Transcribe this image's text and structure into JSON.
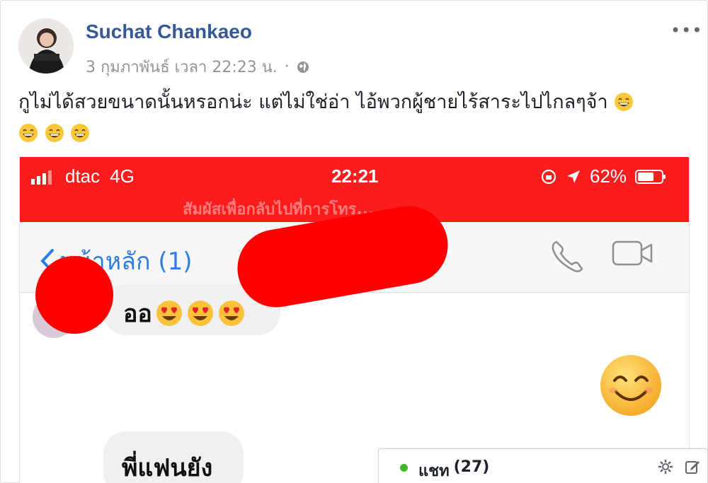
{
  "post": {
    "author": "Suchat Chankaeo",
    "date": "3 กุมภาพันธ์ เวลา 22:23 น.",
    "separator": "·",
    "more_label": "•••",
    "text_line1": "กูไม่ได้สวยขนาดนั้นหรอกน่ะ แต่ไม่ใช่อ่า ไอ้พวกผู้ชายไร้สาระไปไกลๆจ้า",
    "icons": {
      "privacy": "globe-icon",
      "emoji": "grinning-face-icon"
    }
  },
  "screenshot": {
    "status_bar": {
      "carrier": "dtac",
      "network": "4G",
      "time": "22:21",
      "battery": "62%",
      "faded_banner": "สัมผัสเพื่อกลับไปที่การโทร..."
    },
    "nav": {
      "back_label": "หน้าหลัก (1)",
      "icons": [
        "phone-icon",
        "video-call-icon"
      ]
    },
    "messages": [
      {
        "text": "ออ",
        "emojis": [
          "heart-eyes-icon",
          "heart-eyes-icon",
          "heart-eyes-icon"
        ]
      },
      {
        "sticker": "smiling-face-icon"
      },
      {
        "text": "พี่แฟนยัง"
      }
    ],
    "colors": {
      "status_bar": "#fb1d1d",
      "redaction": "#ff0000",
      "link_blue": "#2e7de6"
    }
  },
  "chat": {
    "label": "แชท",
    "count": "(27)",
    "online_color": "#42b72a"
  }
}
